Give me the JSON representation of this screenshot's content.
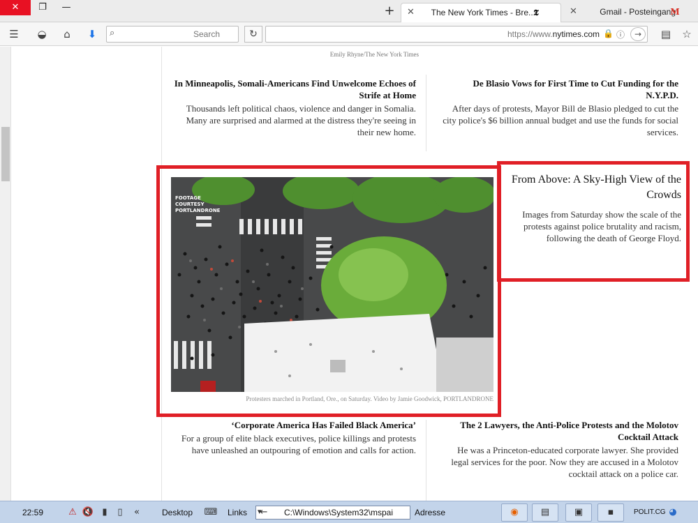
{
  "window": {
    "close": "✕",
    "restore": "❐",
    "minimize": "—"
  },
  "tabs": [
    {
      "label": "The New York Times - Bre...",
      "icon": "𝕿",
      "close": "✕"
    },
    {
      "label": "Gmail - Posteingang",
      "icon": "M",
      "close": "✕"
    }
  ],
  "new_tab": "+",
  "nav": {
    "menu_icon": "☰",
    "pocket_icon": "◒",
    "home_icon": "⌂",
    "download_icon": "⬇",
    "search_placeholder": "Search",
    "search_icon": "⌕",
    "reload_icon": "↻",
    "url_scheme": "https://www.",
    "url_domain": "nytimes.com",
    "lock_icon": "🔒",
    "info_icon": "ⓘ",
    "go_icon": "→",
    "reader_icon": "▤",
    "bookmark_icon": "☆"
  },
  "page": {
    "top_caption_line1": "Emily Rhyne/The New York Times",
    "stories_top": [
      {
        "headline": "De Blasio Vows for First Time to Cut Funding for the N.Y.P.D.",
        "summary": "After days of protests, Mayor Bill de Blasio pledged to cut the city police's $6 billion annual budget and use the funds for social services."
      },
      {
        "headline": "In Minneapolis, Somali-Americans Find Unwelcome Echoes of Strife at Home",
        "summary": "Thousands left political chaos, violence and danger in Somalia. Many are surprised and alarmed at the distress they're seeing in their new home."
      }
    ],
    "feature": {
      "headline": "From Above: A Sky-High View of the Crowds",
      "summary": "Images from Saturday show the scale of the protests against police brutality and racism, following the death of George Floyd.",
      "photo_caption": "Protesters marched in Portland, Ore., on Saturday. Video by Jamie Goodwick, PORTLANDRONE",
      "watermark": "FOOTAGE COURTESY PORTLANDRONE"
    },
    "stories_bottom": [
      {
        "headline": "The 2 Lawyers, the Anti-Police Protests and the Molotov Cocktail Attack",
        "summary": "He was a Princeton-educated corporate lawyer. She provided legal services for the poor. Now they are accused in a Molotov cocktail attack on a police car."
      },
      {
        "headline": "‘Corporate America Has Failed Black America’",
        "summary": "For a group of elite black executives, police killings and protests have unleashed an outpouring of emotion and calls for action."
      }
    ]
  },
  "taskbar": {
    "clock": "22:59",
    "desktop_label": "Desktop",
    "links_label": "Links",
    "address_label": "Adresse",
    "address_value": "C:\\Windows\\System32\\mspai",
    "start_label": "POLIT.CG"
  },
  "colors": {
    "highlight_red": "#e01f26",
    "close_red": "#e81123",
    "taskbar": "#c3d4ea"
  }
}
